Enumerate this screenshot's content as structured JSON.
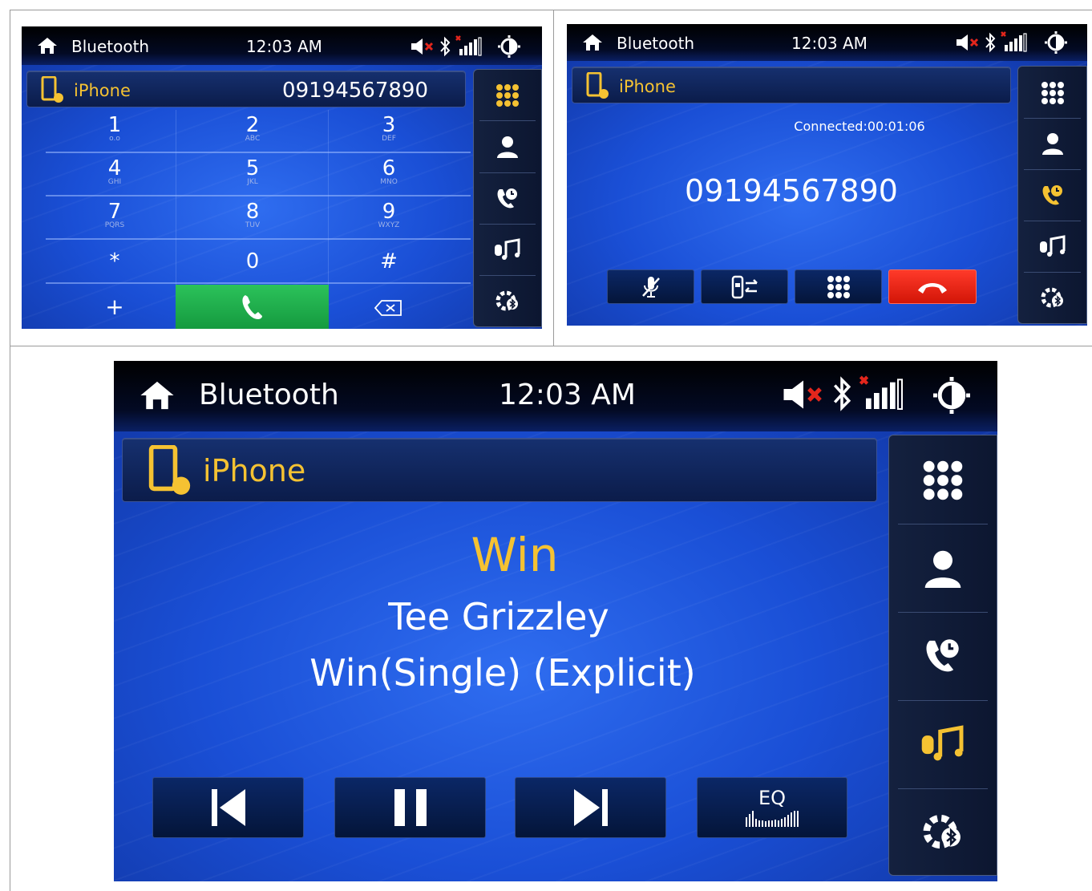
{
  "colors": {
    "accent_yellow": "#f5c232",
    "call_green": "#1faa48",
    "end_red": "#e11f0f",
    "screen_blue": "#1a4fd6"
  },
  "status_bar": {
    "title": "Bluetooth",
    "time": "12:03 AM",
    "icons": [
      "home-icon",
      "mute-icon",
      "bluetooth-icon",
      "signal-icon",
      "brightness-icon"
    ]
  },
  "device": {
    "name": "iPhone",
    "icon": "phone-bluetooth-icon"
  },
  "side_menu": [
    "keypad-icon",
    "contacts-icon",
    "call-history-icon",
    "bt-music-icon",
    "bt-settings-icon"
  ],
  "dialer": {
    "number": "09194567890",
    "keys": [
      {
        "digit": "1",
        "letters": "o.o"
      },
      {
        "digit": "2",
        "letters": "ABC"
      },
      {
        "digit": "3",
        "letters": "DEF"
      },
      {
        "digit": "4",
        "letters": "GHI"
      },
      {
        "digit": "5",
        "letters": "JKL"
      },
      {
        "digit": "6",
        "letters": "MNO"
      },
      {
        "digit": "7",
        "letters": "PQRS"
      },
      {
        "digit": "8",
        "letters": "TUV"
      },
      {
        "digit": "9",
        "letters": "WXYZ"
      },
      {
        "digit": "*",
        "letters": ""
      },
      {
        "digit": "0",
        "letters": ""
      },
      {
        "digit": "#",
        "letters": ""
      }
    ],
    "plus": "+"
  },
  "call": {
    "status": "Connected:00:01:06",
    "number": "09194567890",
    "controls": [
      "mic-mute-icon",
      "transfer-audio-icon",
      "keypad-icon",
      "end-call-icon"
    ]
  },
  "music": {
    "title": "Win",
    "artist": "Tee Grizzley",
    "album": "Win(Single) (Explicit)",
    "eq_label": "EQ"
  }
}
